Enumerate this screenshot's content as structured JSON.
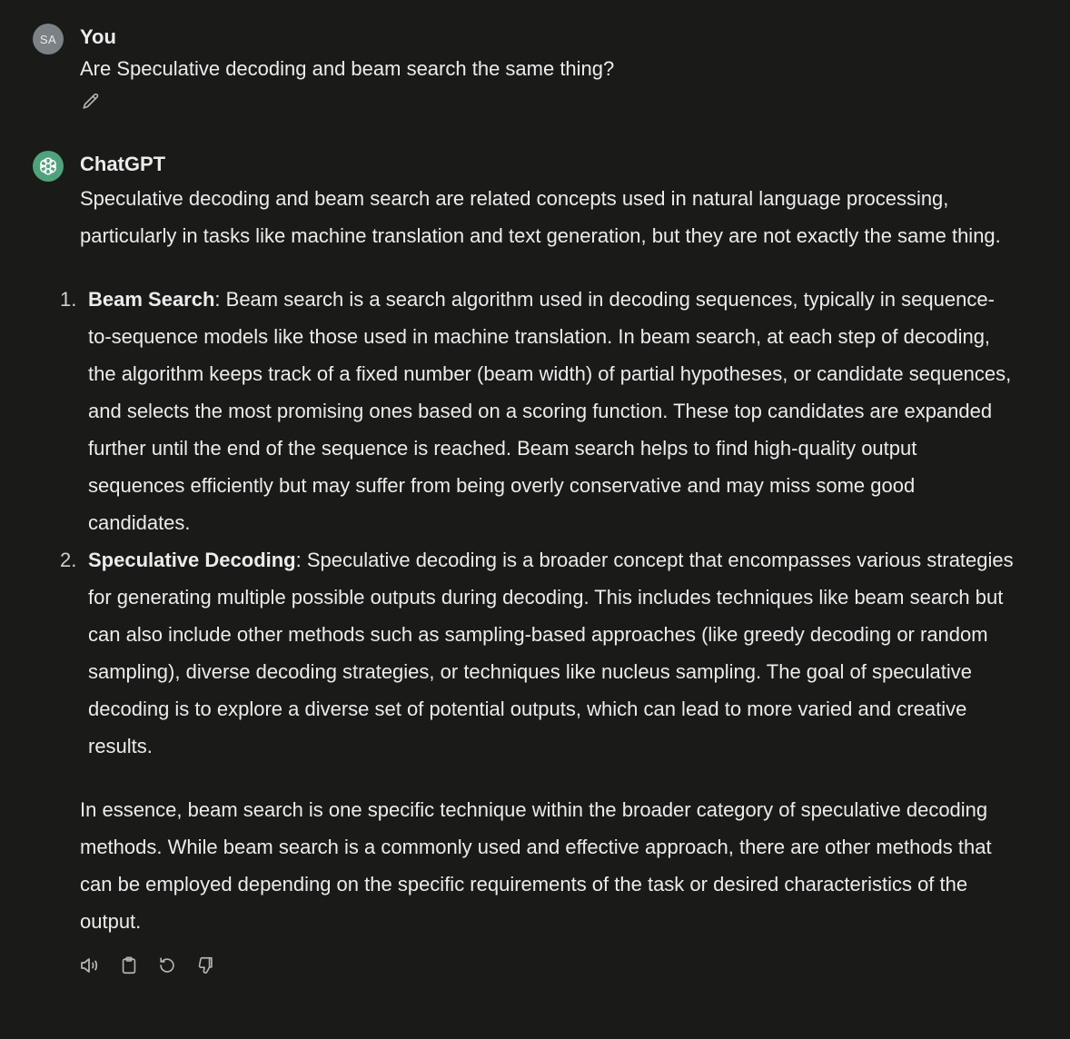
{
  "user_turn": {
    "avatar_initials": "SA",
    "author": "You",
    "message": "Are  Speculative decoding and beam search the same thing?"
  },
  "assistant_turn": {
    "author": "ChatGPT",
    "intro": "Speculative decoding and beam search are related concepts used in natural language processing, particularly in tasks like machine translation and text generation, but they are not exactly the same thing.",
    "points": [
      {
        "number": "1.",
        "term": "Beam Search",
        "text": ": Beam search is a search algorithm used in decoding sequences, typically in sequence-to-sequence models like those used in machine translation. In beam search, at each step of decoding, the algorithm keeps track of a fixed number (beam width) of partial hypotheses, or candidate sequences, and selects the most promising ones based on a scoring function. These top candidates are expanded further until the end of the sequence is reached. Beam search helps to find high-quality output sequences efficiently but may suffer from being overly conservative and may miss some good candidates."
      },
      {
        "number": "2.",
        "term": "Speculative Decoding",
        "text": ": Speculative decoding is a broader concept that encompasses various strategies for generating multiple possible outputs during decoding. This includes techniques like beam search but can also include other methods such as sampling-based approaches (like greedy decoding or random sampling), diverse decoding strategies, or techniques like nucleus sampling. The goal of speculative decoding is to explore a diverse set of potential outputs, which can lead to more varied and creative results."
      }
    ],
    "summary": "In essence, beam search is one specific technique within the broader category of speculative decoding methods. While beam search is a commonly used and effective approach, there are other methods that can be employed depending on the specific requirements of the task or desired characteristics of the output."
  },
  "icons": {
    "edit": "pencil-icon",
    "assistant_logo": "openai-logo-icon",
    "read_aloud": "speaker-icon",
    "copy": "clipboard-icon",
    "regenerate": "refresh-icon",
    "dislike": "thumbs-down-icon"
  },
  "colors": {
    "background": "#1a1a19",
    "text": "#ececec",
    "user_avatar": "#7b8184",
    "assistant_avatar": "#4fa37c",
    "icon": "#b4b4b4"
  }
}
